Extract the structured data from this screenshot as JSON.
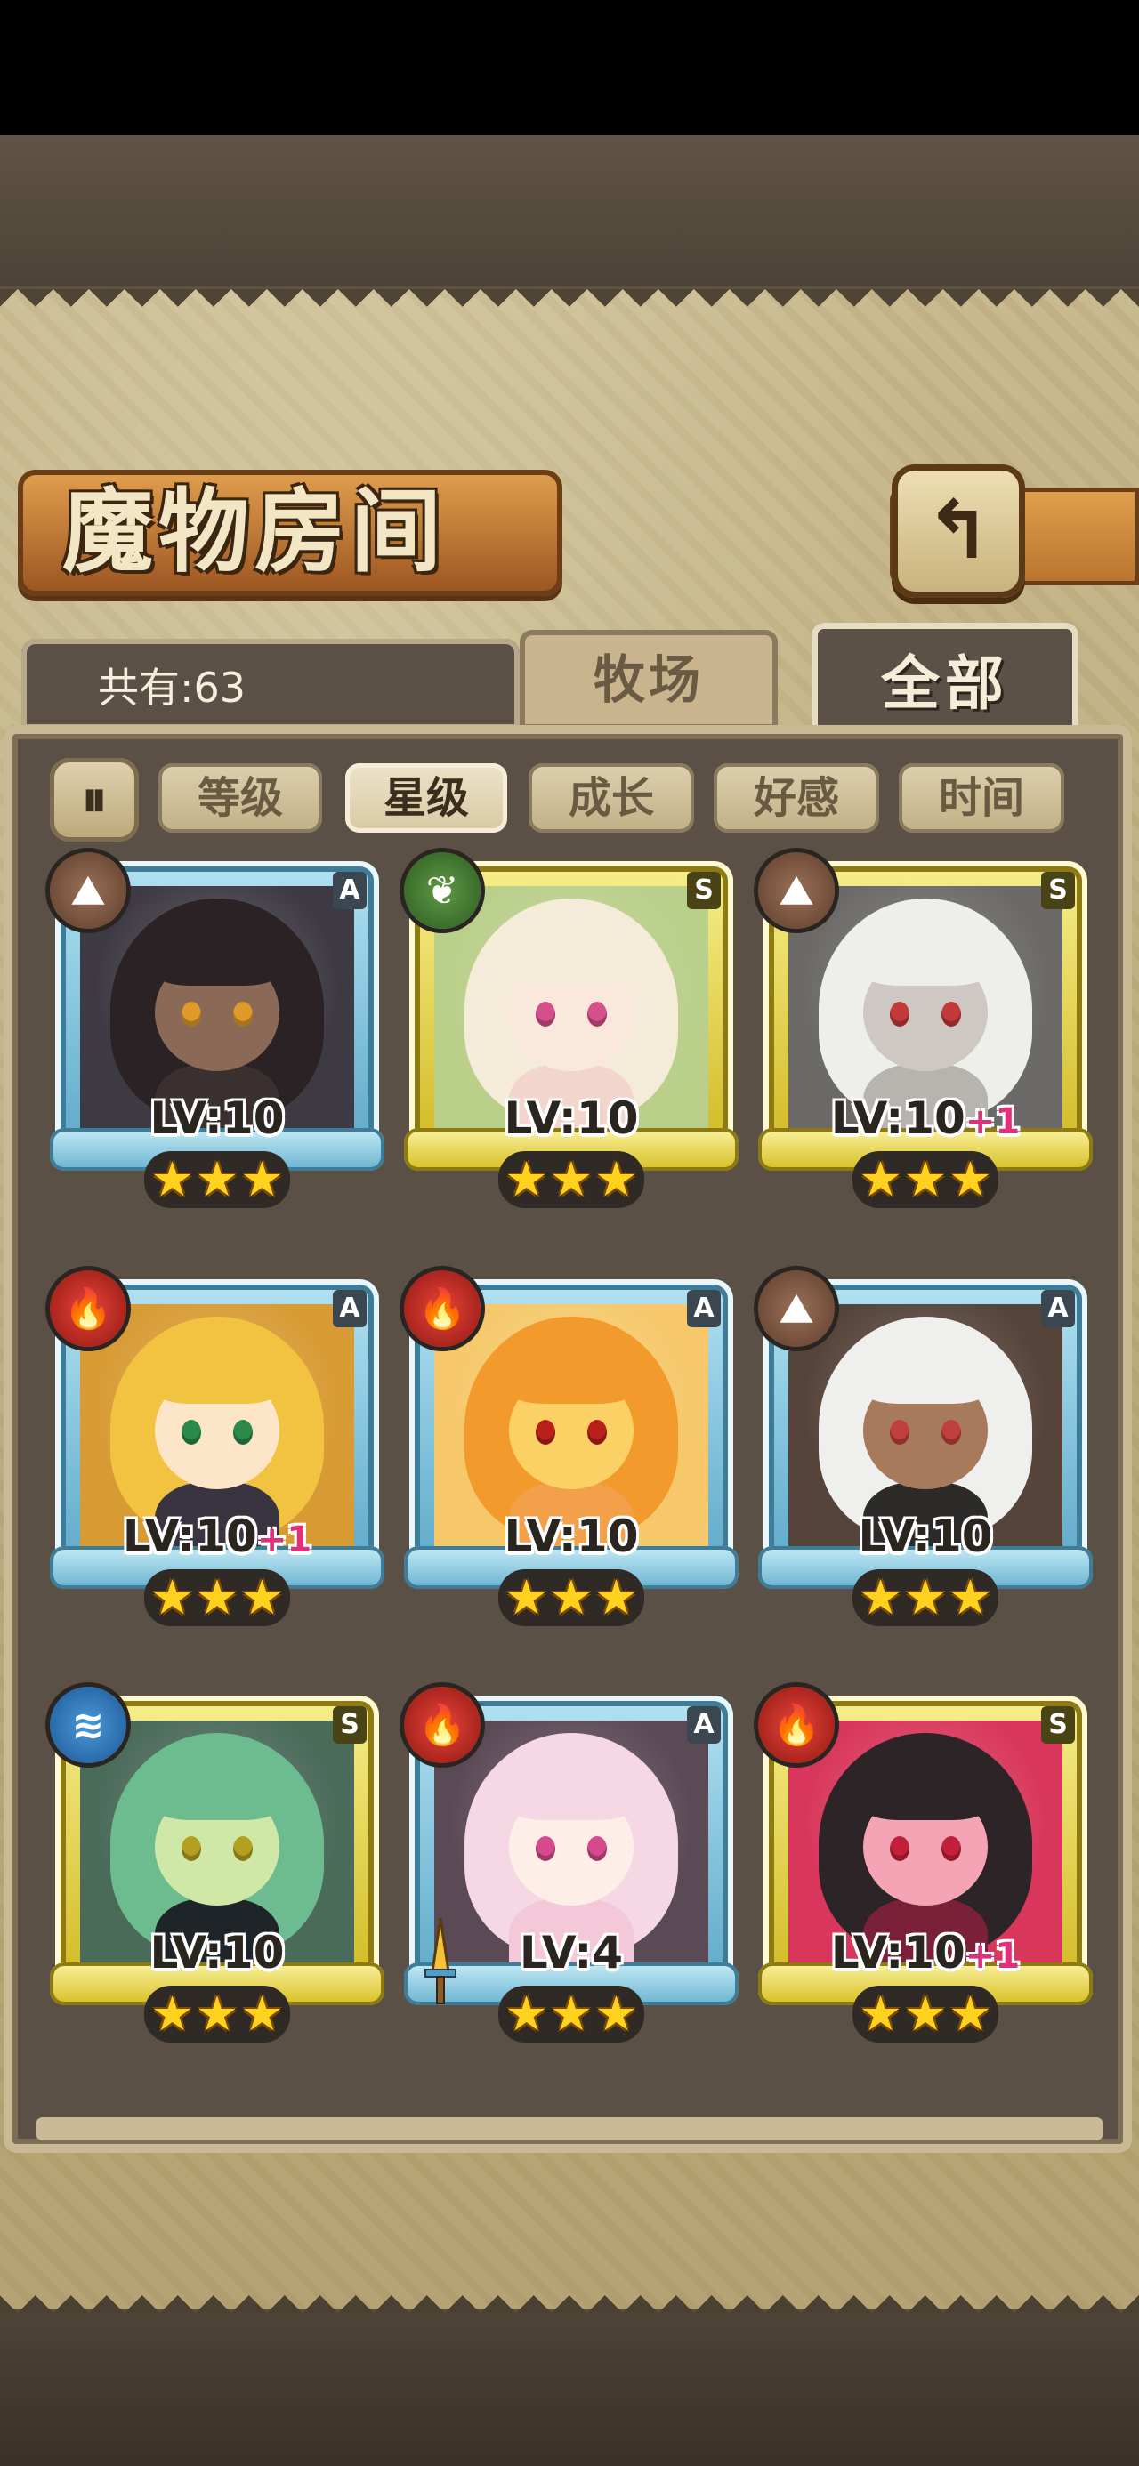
{
  "title": "魔物房间",
  "back_button": {
    "icon": "back-arrow-icon",
    "glyph": "↰"
  },
  "count_label": "共有:63",
  "tabs": {
    "ranch": "牧场",
    "all": "全部",
    "active": "all"
  },
  "sort": {
    "toggle_glyph": "⏸",
    "options": [
      "等级",
      "星级",
      "成长",
      "好感",
      "时间"
    ],
    "active": "星级"
  },
  "cards": [
    {
      "rarity": "A",
      "element": "earth",
      "level": "LV:10",
      "bonus": "",
      "stars": 3,
      "hair": "#2a2224",
      "skin": "#8a6a56",
      "bg": "#3e3a44",
      "body": "#3a3030",
      "eye": "#e09a2a"
    },
    {
      "rarity": "S",
      "element": "leaf",
      "level": "LV:10",
      "bonus": "",
      "stars": 3,
      "hair": "#f4ecd8",
      "skin": "#fbe8dc",
      "bg": "#b9cf8a",
      "body": "#f2d6cc",
      "eye": "#d4508a"
    },
    {
      "rarity": "S",
      "element": "earth",
      "level": "LV:10",
      "bonus": "+1",
      "stars": 3,
      "hair": "#eeeeea",
      "skin": "#cfc7c2",
      "bg": "#6c6a68",
      "body": "#b7b4b0",
      "eye": "#c23a3a"
    },
    {
      "rarity": "A",
      "element": "fire",
      "level": "LV:10",
      "bonus": "+1",
      "stars": 3,
      "hair": "#f2c340",
      "skin": "#fde6c8",
      "bg": "#d89b34",
      "body": "#3a3340",
      "eye": "#2a8a4a"
    },
    {
      "rarity": "A",
      "element": "fire",
      "level": "LV:10",
      "bonus": "",
      "stars": 3,
      "hair": "#f39a2c",
      "skin": "#fbd166",
      "bg": "#f6c86a",
      "body": "#f3a04a",
      "eye": "#b8201a"
    },
    {
      "rarity": "A",
      "element": "earth",
      "level": "LV:10",
      "bonus": "",
      "stars": 3,
      "hair": "#efefee",
      "skin": "#a77a5c",
      "bg": "#56443a",
      "body": "#2d2a2a",
      "eye": "#c04040"
    },
    {
      "rarity": "S",
      "element": "water",
      "level": "LV:10",
      "bonus": "",
      "stars": 3,
      "hair": "#6cbc90",
      "skin": "#cfe8a8",
      "bg": "#4a6a5a",
      "body": "#1e2428",
      "eye": "#b4a020"
    },
    {
      "rarity": "A",
      "element": "fire",
      "level": "LV:4",
      "bonus": "",
      "stars": 3,
      "hair": "#f6d8e4",
      "skin": "#fdeee8",
      "bg": "#5a4a56",
      "body": "#f3c8d8",
      "eye": "#d44a8a"
    },
    {
      "rarity": "S",
      "element": "fire",
      "level": "LV:10",
      "bonus": "+1",
      "stars": 3,
      "hair": "#2d2428",
      "skin": "#f4a4b4",
      "bg": "#d8365a",
      "body": "#7a2038",
      "eye": "#c2203a"
    }
  ],
  "element_glyphs": {
    "earth": "⛰",
    "fire": "🔥",
    "leaf": "❦",
    "water": "≋"
  },
  "star_glyph": "★"
}
